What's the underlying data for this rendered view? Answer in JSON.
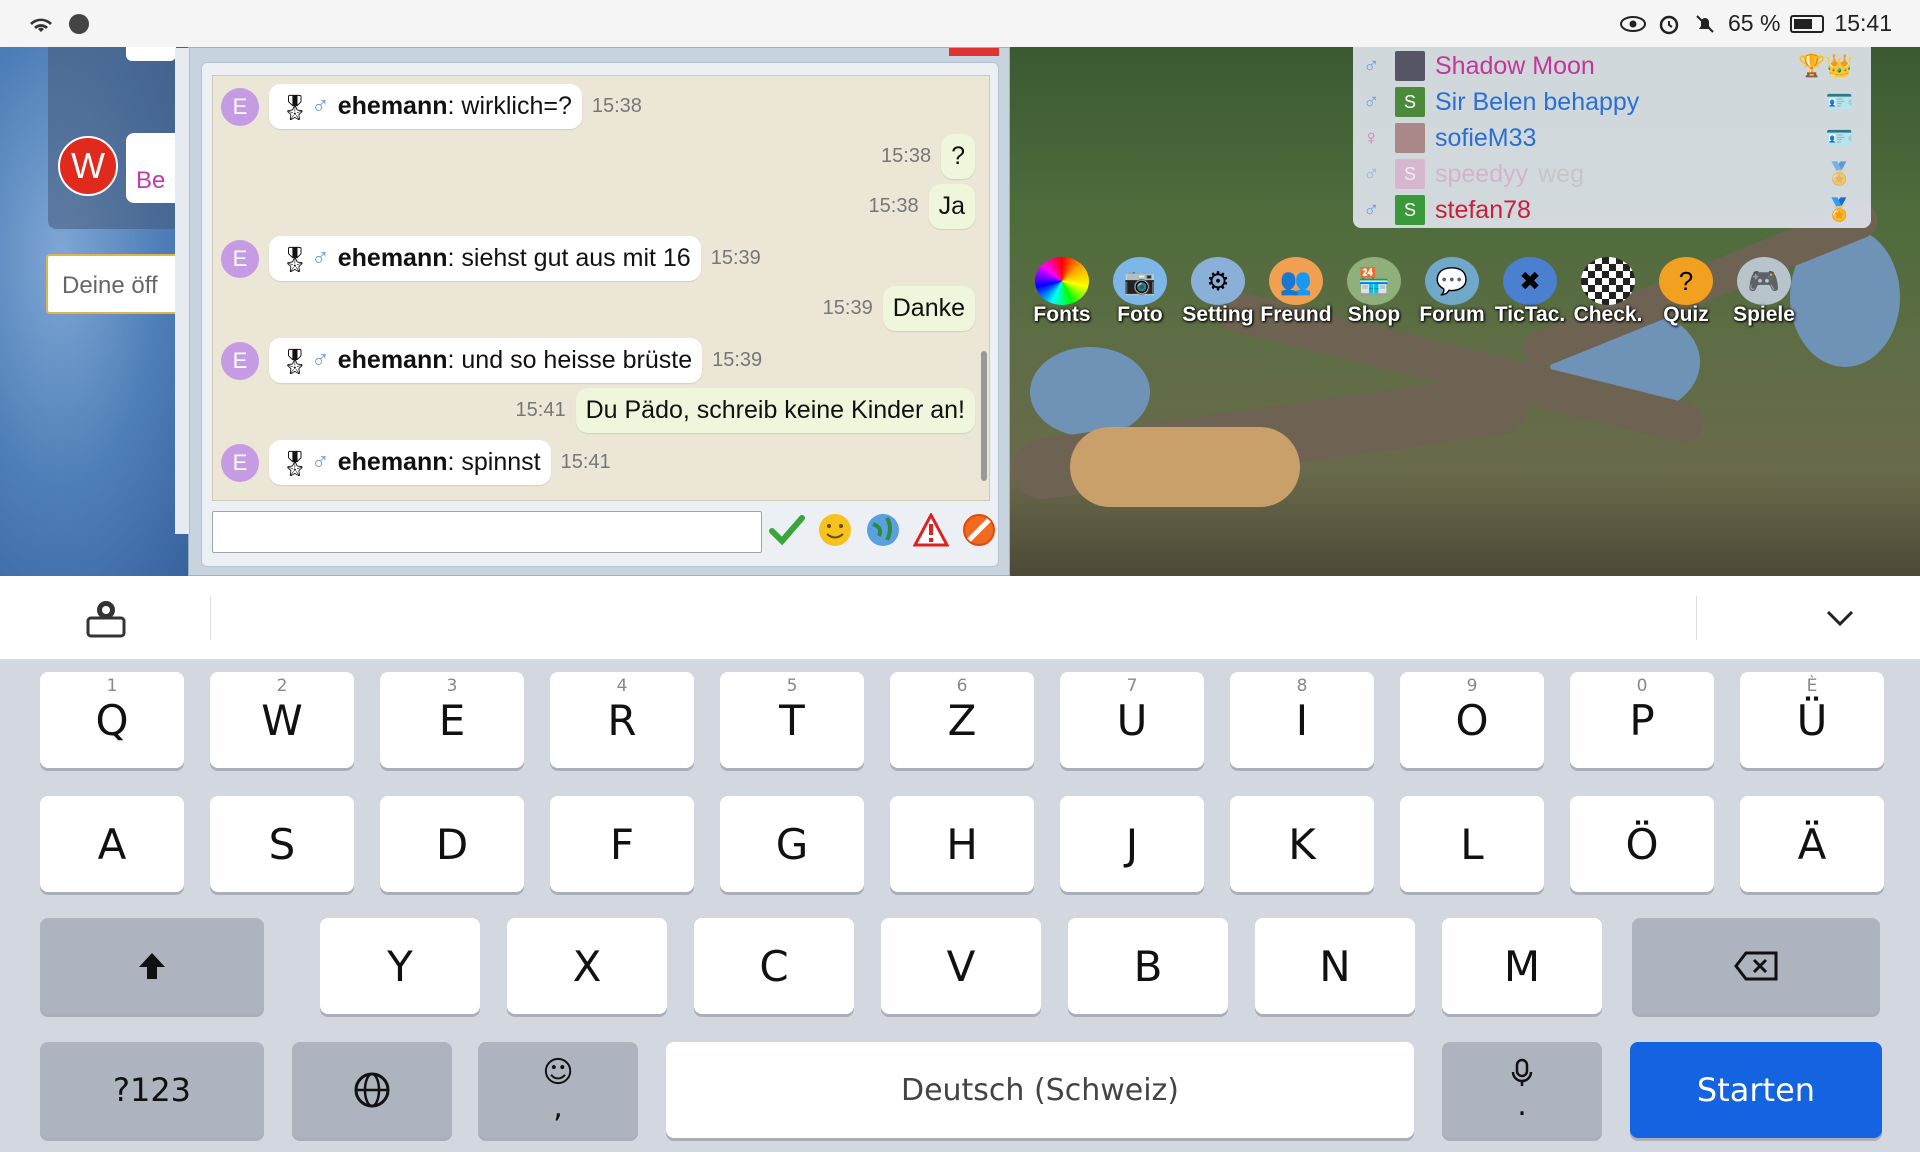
{
  "statusbar": {
    "battery": "65 %",
    "time": "15:41"
  },
  "profile": {
    "avatar_letter": "W",
    "badge_text": "Be",
    "status_placeholder": "Deine öff"
  },
  "chat": {
    "messages": [
      {
        "dir": "in",
        "avatar": "E",
        "user": "ehemann",
        "text": ": wirklich=?",
        "time": "15:38"
      },
      {
        "dir": "out",
        "text": "?",
        "time": "15:38"
      },
      {
        "dir": "out",
        "text": "Ja",
        "time": "15:38"
      },
      {
        "dir": "in",
        "avatar": "E",
        "user": "ehemann",
        "text": ": siehst gut aus mit 16",
        "time": "15:39"
      },
      {
        "dir": "out",
        "text": "Danke",
        "time": "15:39"
      },
      {
        "dir": "in",
        "avatar": "E",
        "user": "ehemann",
        "text": ": und so heisse brüste",
        "time": "15:39"
      },
      {
        "dir": "out",
        "text": "Du Pädo, schreib keine Kinder an!",
        "time": "15:41"
      },
      {
        "dir": "in",
        "avatar": "E",
        "user": "ehemann",
        "text": ": spinnst",
        "time": "15:41"
      }
    ],
    "input_value": ""
  },
  "userlist": [
    {
      "name": "Shadow Moon",
      "color": "#c0389a",
      "avatar": "",
      "avatar_color": "#556"
    },
    {
      "name": "Sir Belen behappy",
      "color": "#2a6fd6",
      "avatar": "S",
      "avatar_color": "#4a8a3a"
    },
    {
      "name": "sofieM33",
      "color": "#2a6fd6",
      "avatar": "",
      "avatar_color": "#a88"
    },
    {
      "name": "speedyy",
      "color": "#d89bbf",
      "avatar": "S",
      "avatar_color": "#d9a2c4",
      "suffix": "weg"
    },
    {
      "name": "stefan78",
      "color": "#c8203a",
      "avatar": "S",
      "avatar_color": "#3a9a3a"
    }
  ],
  "apps": [
    "Fonts",
    "Foto",
    "Setting",
    "Freund",
    "Shop",
    "Forum",
    "TicTac.",
    "Check.",
    "Quiz",
    "Spiele"
  ],
  "keyboard": {
    "row1": [
      {
        "k": "Q",
        "n": "1"
      },
      {
        "k": "W",
        "n": "2"
      },
      {
        "k": "E",
        "n": "3"
      },
      {
        "k": "R",
        "n": "4"
      },
      {
        "k": "T",
        "n": "5"
      },
      {
        "k": "Z",
        "n": "6"
      },
      {
        "k": "U",
        "n": "7"
      },
      {
        "k": "I",
        "n": "8"
      },
      {
        "k": "O",
        "n": "9"
      },
      {
        "k": "P",
        "n": "0"
      },
      {
        "k": "Ü",
        "n": "È"
      }
    ],
    "row2": [
      "A",
      "S",
      "D",
      "F",
      "G",
      "H",
      "J",
      "K",
      "L",
      "Ö",
      "Ä"
    ],
    "row3": [
      "Y",
      "X",
      "C",
      "V",
      "B",
      "N",
      "M"
    ],
    "numkey": "?123",
    "comma": ",",
    "period": ".",
    "space_label": "Deutsch (Schweiz)",
    "enter_label": "Starten"
  }
}
